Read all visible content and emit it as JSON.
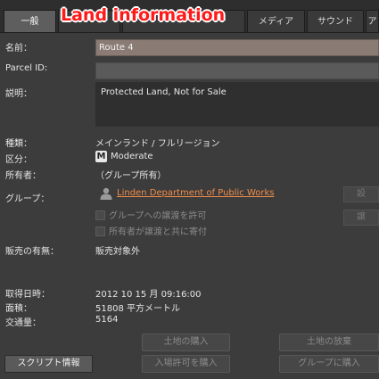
{
  "tabs": [
    {
      "label": "一般",
      "active": true
    },
    {
      "label": "",
      "active": false
    },
    {
      "label": "",
      "active": false
    },
    {
      "label": "メディア",
      "active": false
    },
    {
      "label": "サウンド",
      "active": false
    },
    {
      "label": "ア",
      "active": false
    }
  ],
  "overlay_title": "Land information",
  "form": {
    "name_label": "名前：",
    "name_value": "Route 4",
    "parcel_id_label": "Parcel ID:",
    "parcel_id_value": "",
    "description_label": "説明：",
    "description_value": "Protected Land, Not for Sale",
    "type_label": "種類：",
    "type_value": "メインランド / フルリージョン",
    "rating_label": "区分：",
    "rating_badge": "M",
    "rating_value": "Moderate",
    "owner_label": "所有者：",
    "owner_value": "（グループ所有）",
    "group_label": "グループ：",
    "group_value": "Linden Department of Public Works",
    "checkbox_allow_deed": "グループへの譲渡を許可",
    "checkbox_owner_contribute": "所有者が譲渡と共に寄付",
    "for_sale_label": "販売の有無：",
    "for_sale_value": "販売対象外",
    "acquired_label": "取得日時：",
    "acquired_value": "2012 10 15 月 09:16:00",
    "area_label": "面積：",
    "area_value": "51808 平方メートル",
    "traffic_label": "交通量：",
    "traffic_value": "5164"
  },
  "side_buttons": {
    "group_button": "設",
    "deed_button": "譲"
  },
  "buttons": {
    "script_info": "スクリプト情報",
    "buy_land": "土地の購入",
    "buy_pass": "入場許可を購入",
    "abandon_land": "土地の放棄",
    "buy_for_group": "グループに購入"
  }
}
